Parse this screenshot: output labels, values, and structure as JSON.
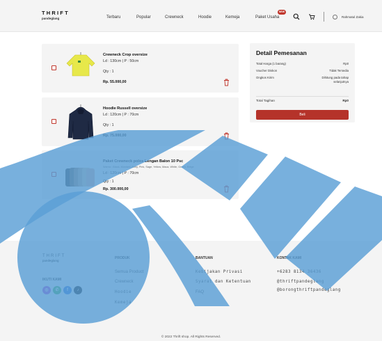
{
  "brand": {
    "line1": "THRIFT",
    "line2": "pandeglang"
  },
  "nav": {
    "items": [
      "Terbaru",
      "Popular",
      "Crewneck",
      "Hoodie",
      "Kemeja",
      "Paket Usaha"
    ],
    "badge": "NEW",
    "user_name": "Rahmatul Zakia"
  },
  "cart": {
    "items": [
      {
        "name": "Crewneck Crop oversize",
        "size": "Ld : 130cm | P : 50cm",
        "qty": "Qty : 1",
        "price": "Rp. 55.000,00"
      },
      {
        "name": "Hoodie Russell oversize",
        "size": "Ld : 120cm | P : 70cm",
        "qty": "Qty : 1",
        "price": "Rp. 75.000,00"
      },
      {
        "name": "Paket Crewneck polos Lengan Balon 10 Psc",
        "variant": "Warna : Black, Mustard, Army, Pink, Sage, Yellow, Maca, White, Green, Beige",
        "size": "Ld : 120cm | P : 70cm",
        "qty": "Qty : 1",
        "price": "Rp. 300.000,00"
      }
    ]
  },
  "summary": {
    "title": "Detail Pemesanan",
    "rows": [
      {
        "label": "Total Harga (1 barang)",
        "value": "Rp0"
      },
      {
        "label": "Voucher Diskon",
        "value": "Tidak Tersedia"
      },
      {
        "label": "Ongkos Kirim",
        "value": "Dihitung pada tahap",
        "value2": "selanjutnya"
      }
    ],
    "total_label": "Total Tagihan",
    "total_value": "Rp0",
    "buy_label": "Beli"
  },
  "footer": {
    "follow_label": "IKUTI KAMI",
    "produk": {
      "title": "PRODUK",
      "items": [
        "Semua Product",
        "Crewneck",
        "Hoodie",
        "Kemeja"
      ]
    },
    "bantuan": {
      "title": "BANTUAN",
      "items": [
        "Kebijakan Privasi",
        "Syarat dan Ketentuan",
        "FAQ"
      ]
    },
    "kontak": {
      "title": "KONTAK KAMI",
      "items": [
        "+6283 8134 36436",
        "@thriftpandeglang",
        "@borongthriftpandeglang"
      ]
    },
    "socials": [
      {
        "icon": "instagram-icon",
        "color": "#b040d0"
      },
      {
        "icon": "whatsapp-icon",
        "color": "#38b34a"
      },
      {
        "icon": "facebook-icon",
        "color": "#2f6fd6"
      },
      {
        "icon": "tiktok-icon",
        "color": "#111111"
      }
    ],
    "copyright": "© 2022 Thrift shop. All Rights Reserved."
  },
  "colors": {
    "accent": "#b5332a",
    "watermark": "#5a9fd6"
  }
}
